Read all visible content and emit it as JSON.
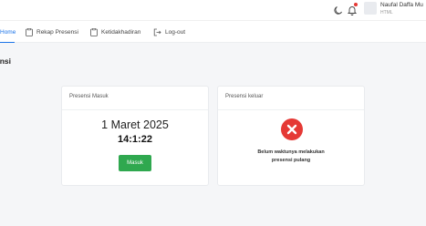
{
  "header": {
    "user_name": "Naufal Daffa Mu",
    "user_role": "HTML",
    "icons": {
      "theme": "moon-icon",
      "notifications": "bell-icon"
    },
    "notification_dot_color": "#e53935"
  },
  "nav": {
    "items": [
      {
        "label": "Home",
        "icon": "home-icon",
        "active": true
      },
      {
        "label": "Rekap Presensi",
        "icon": "clipboard-icon"
      },
      {
        "label": "Ketidakhadiran",
        "icon": "clipboard-icon"
      },
      {
        "label": "Log-out",
        "icon": "logout-icon"
      }
    ],
    "accent_color": "#1a73e8"
  },
  "page": {
    "title": "ensi"
  },
  "cards": {
    "masuk": {
      "title": "Presensi Masuk",
      "date": "1 Maret 2025",
      "time": "14:1:22",
      "button_label": "Masuk",
      "button_color": "#2fa84f"
    },
    "keluar": {
      "title": "Presensi keluar",
      "icon": "x-circle-icon",
      "icon_color": "#e53935",
      "message_line1": "Belum waktunya melakukan",
      "message_line2": "presensi pulang"
    }
  }
}
